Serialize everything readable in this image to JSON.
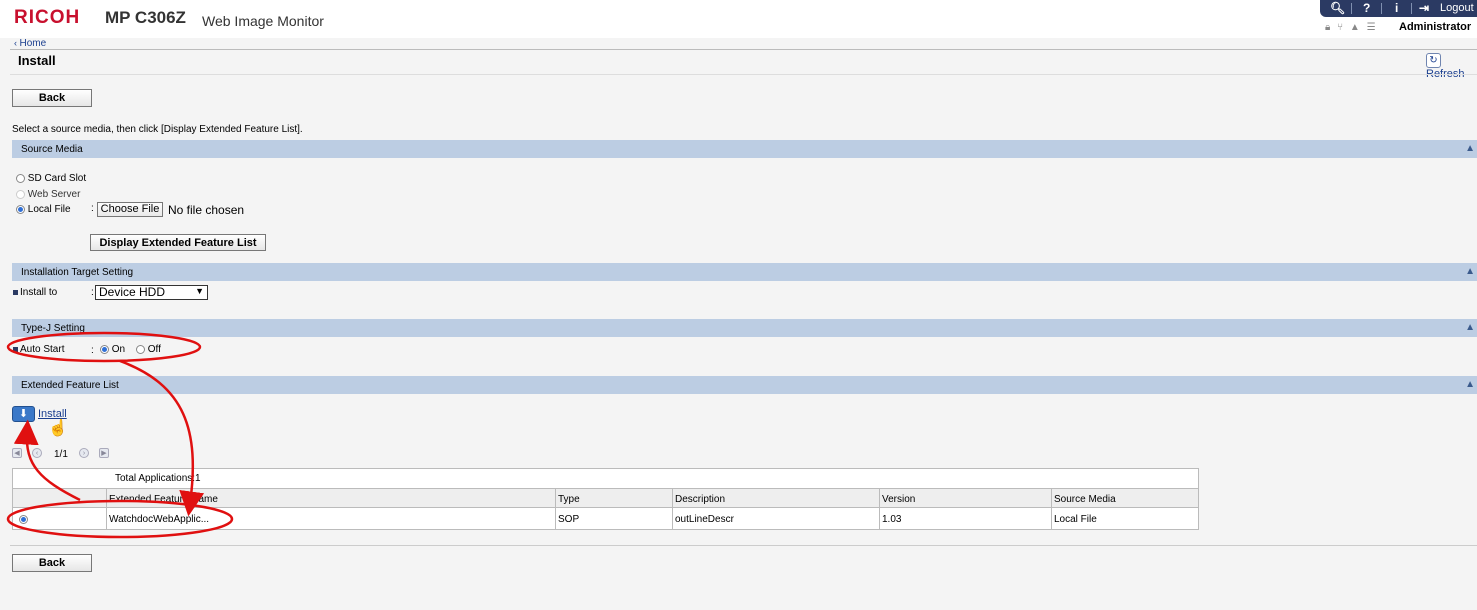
{
  "header": {
    "brand": "RICOH",
    "model": "MP C306Z",
    "app_name": "Web Image Monitor",
    "logout_label": "Logout",
    "user": "Administrator",
    "brand_color": "#c8102e"
  },
  "nav": {
    "home_label": "Home",
    "page_title": "Install",
    "refresh_label": "Refresh"
  },
  "buttons": {
    "back_top": "Back",
    "back_bottom": "Back",
    "display_list": "Display Extended Feature List",
    "choose_file": "Choose File"
  },
  "instruction": "Select a source media, then click [Display Extended Feature List].",
  "source_media": {
    "title": "Source Media",
    "options": [
      "SD Card Slot",
      "Web Server",
      "Local File"
    ],
    "selected": "Local File",
    "colon": ":",
    "no_file": "No file chosen"
  },
  "target": {
    "title": "Installation Target Setting",
    "label": "Install to",
    "colon": ":",
    "value": "Device HDD"
  },
  "typej": {
    "title": "Type-J Setting",
    "label": "Auto Start",
    "colon": ":",
    "on": "On",
    "off": "Off",
    "selected": "On"
  },
  "feature_list": {
    "title": "Extended Feature List",
    "install_label": "Install",
    "page": "1/1",
    "total": "Total Applications:1",
    "columns": [
      "Extended Feature Name",
      "Type",
      "Description",
      "Version",
      "Source Media"
    ],
    "rows": [
      {
        "name": "WatchdocWebApplic...",
        "type": "SOP",
        "description": "outLineDescr",
        "version": "1.03",
        "source": "Local File"
      }
    ]
  },
  "icons": [
    "search-icon",
    "help-icon",
    "info-icon",
    "logout-icon",
    "lock-icon",
    "network-icon",
    "user-icon",
    "list-icon",
    "refresh-icon",
    "install-icon",
    "collapse-arrow-icon",
    "hand-cursor-icon"
  ],
  "annotation_color": "#e01010"
}
